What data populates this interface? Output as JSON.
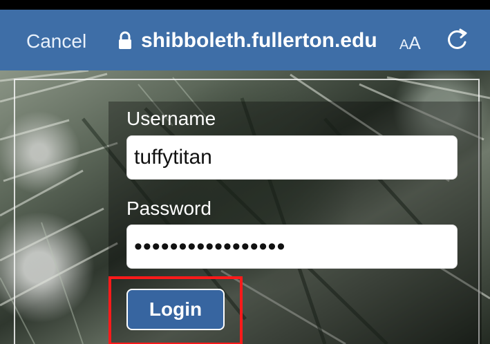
{
  "browser": {
    "cancel_label": "Cancel",
    "url": "shibboleth.fullerton.edu",
    "text_size_label_small": "A",
    "text_size_label_large": "A"
  },
  "login": {
    "username_label": "Username",
    "username_value": "tuffytitan",
    "password_label": "Password",
    "password_value": "•••••••••••••••••",
    "submit_label": "Login"
  },
  "colors": {
    "toolbar_bg": "#3e6ea7",
    "button_bg": "#3765a0",
    "highlight": "#ff1a1a"
  }
}
